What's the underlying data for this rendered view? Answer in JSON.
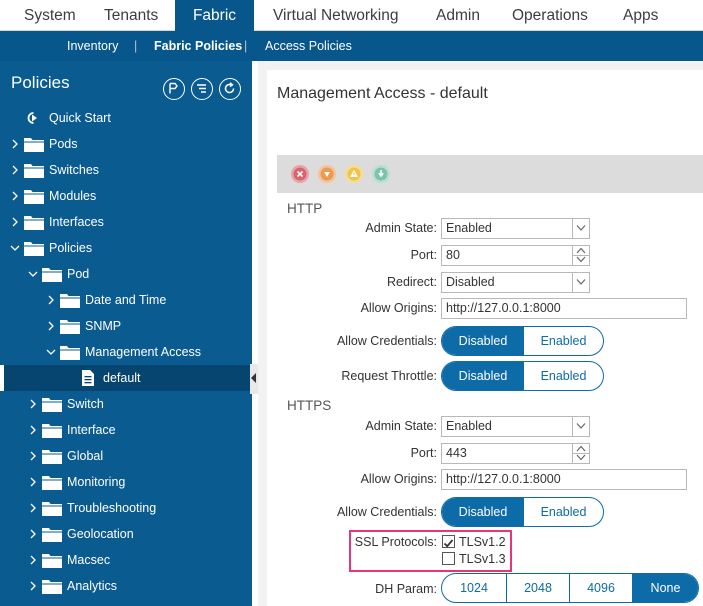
{
  "topnav": {
    "tabs": [
      {
        "label": "System"
      },
      {
        "label": "Tenants"
      },
      {
        "label": "Fabric"
      },
      {
        "label": "Virtual Networking"
      },
      {
        "label": "Admin"
      },
      {
        "label": "Operations"
      },
      {
        "label": "Apps"
      }
    ],
    "active": "Fabric"
  },
  "subnav": {
    "items": [
      {
        "label": "Inventory"
      },
      {
        "label": "Fabric Policies"
      },
      {
        "label": "Access Policies"
      }
    ],
    "active": "Fabric Policies",
    "separator": "|"
  },
  "sidebar": {
    "title": "Policies",
    "tree": [
      {
        "label": "Quick Start",
        "icon": "quick-start-icon"
      },
      {
        "label": "Pods",
        "icon": "folder-icon",
        "expanded": false
      },
      {
        "label": "Switches",
        "icon": "folder-icon",
        "expanded": false
      },
      {
        "label": "Modules",
        "icon": "folder-icon",
        "expanded": false
      },
      {
        "label": "Interfaces",
        "icon": "folder-icon",
        "expanded": false
      },
      {
        "label": "Policies",
        "icon": "folder-icon",
        "expanded": true
      },
      {
        "label": "Pod",
        "icon": "folder-icon",
        "expanded": true
      },
      {
        "label": "Date and Time",
        "icon": "folder-icon",
        "expanded": false
      },
      {
        "label": "SNMP",
        "icon": "folder-icon",
        "expanded": false
      },
      {
        "label": "Management Access",
        "icon": "folder-icon",
        "expanded": true
      },
      {
        "label": "default",
        "icon": "document-icon",
        "selected": true
      },
      {
        "label": "Switch",
        "icon": "folder-icon",
        "expanded": false
      },
      {
        "label": "Interface",
        "icon": "folder-icon",
        "expanded": false
      },
      {
        "label": "Global",
        "icon": "folder-icon",
        "expanded": false
      },
      {
        "label": "Monitoring",
        "icon": "folder-icon",
        "expanded": false
      },
      {
        "label": "Troubleshooting",
        "icon": "folder-icon",
        "expanded": false
      },
      {
        "label": "Geolocation",
        "icon": "folder-icon",
        "expanded": false
      },
      {
        "label": "Macsec",
        "icon": "folder-icon",
        "expanded": false
      },
      {
        "label": "Analytics",
        "icon": "folder-icon",
        "expanded": false
      }
    ]
  },
  "main": {
    "title": "Management Access - default",
    "toolbar_icons": [
      "delete-icon",
      "dislike-icon",
      "warning-icon",
      "info-icon"
    ],
    "http": {
      "section": "HTTP",
      "admin_state_label": "Admin State:",
      "admin_state": "Enabled",
      "port_label": "Port:",
      "port": "80",
      "redirect_label": "Redirect:",
      "redirect": "Disabled",
      "allow_origins_label": "Allow Origins:",
      "allow_origins": "http://127.0.0.1:8000",
      "allow_credentials_label": "Allow Credentials:",
      "allow_credentials": {
        "options": [
          "Disabled",
          "Enabled"
        ],
        "selected": "Disabled"
      },
      "request_throttle_label": "Request Throttle:",
      "request_throttle": {
        "options": [
          "Disabled",
          "Enabled"
        ],
        "selected": "Disabled"
      }
    },
    "https": {
      "section": "HTTPS",
      "admin_state_label": "Admin State:",
      "admin_state": "Enabled",
      "port_label": "Port:",
      "port": "443",
      "allow_origins_label": "Allow Origins:",
      "allow_origins": "http://127.0.0.1:8000",
      "allow_credentials_label": "Allow Credentials:",
      "allow_credentials": {
        "options": [
          "Disabled",
          "Enabled"
        ],
        "selected": "Disabled"
      },
      "ssl_protocols_label": "SSL Protocols:",
      "ssl_protocols": [
        {
          "label": "TLSv1.2",
          "checked": true
        },
        {
          "label": "TLSv1.3",
          "checked": false
        }
      ],
      "dh_param_label": "DH Param:",
      "dh_param": {
        "options": [
          "1024",
          "2048",
          "4096",
          "None"
        ],
        "selected": "None"
      }
    }
  },
  "colors": {
    "brand_dark": "#08578c",
    "sidebar": "#0a5b8f",
    "accent": "#0d6ba8",
    "highlight": "#e8347a"
  }
}
